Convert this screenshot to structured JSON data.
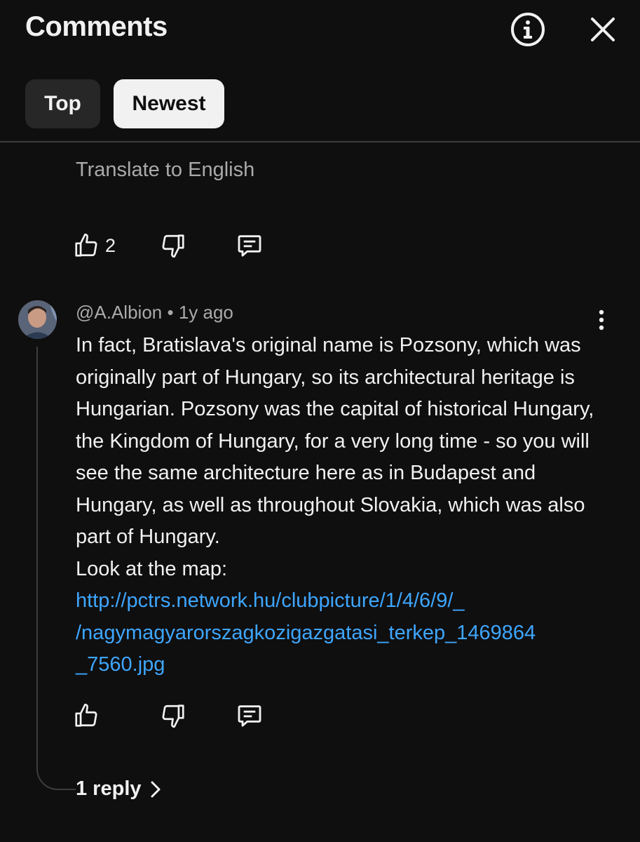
{
  "header": {
    "title": "Comments",
    "info_icon": "info-circle-icon",
    "close_icon": "close-icon"
  },
  "sort": {
    "top_label": "Top",
    "newest_label": "Newest",
    "selected": "Newest"
  },
  "previous_comment": {
    "translate_label": "Translate to English",
    "like_count": "2"
  },
  "comment": {
    "author": "@A.Albion",
    "separator": "•",
    "age": "1y ago",
    "text": "In fact, Bratislava's original name is Pozsony, which was originally part of Hungary, so its architectural heritage is Hungarian. Pozsony was the capital of historical Hungary, the Kingdom of Hungary, for a very long time - so you will see the same architecture here as in Budapest and Hungary, as well as throughout Slovakia, which was also part of Hungary.",
    "text2": "Look at the map:",
    "link_line1": "http://pctrs.network.hu/clubpicture/1/4/6/9/_",
    "link_line2": "/nagymagyarorszagkozigazgatasi_terkep_1469864",
    "link_line3": "_7560.jpg",
    "replies_label": "1 reply"
  },
  "colors": {
    "background": "#0f0f0f",
    "text_primary": "#f1f1f1",
    "text_secondary": "#aaaaaa",
    "link": "#3ea6ff",
    "chip_inactive": "#272727",
    "chip_active": "#f1f1f1"
  }
}
